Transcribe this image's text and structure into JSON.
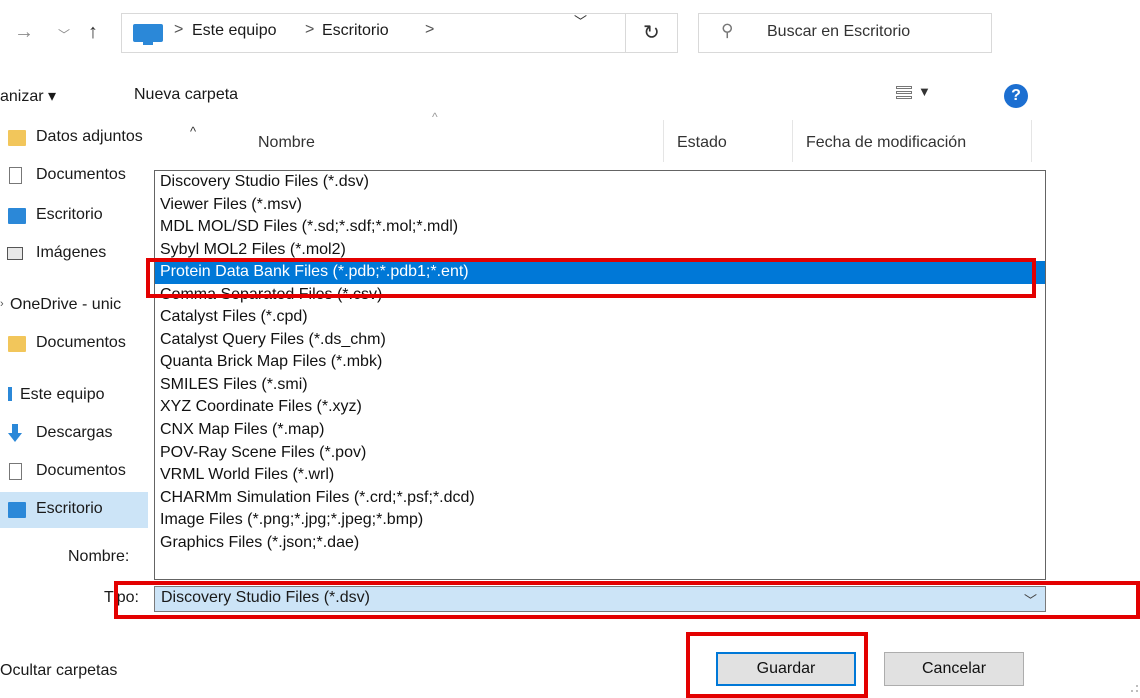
{
  "address_bar": {
    "breadcrumbs": [
      "Este equipo",
      "Escritorio"
    ],
    "separator": ">",
    "search_placeholder": "Buscar en Escritorio"
  },
  "toolbar": {
    "organize_label": "anizar ▾",
    "new_folder_label": "Nueva carpeta"
  },
  "columns": {
    "name": "Nombre",
    "status": "Estado",
    "modified": "Fecha de modificación"
  },
  "nav": {
    "items": [
      {
        "label": "Datos adjuntos",
        "icon": "folder-icon"
      },
      {
        "label": "Documentos",
        "icon": "document-icon"
      },
      {
        "label": "Escritorio",
        "icon": "desktop-icon"
      },
      {
        "label": "Imágenes",
        "icon": "pictures-icon"
      },
      {
        "label": "OneDrive - unic",
        "icon": "chevron-right-icon"
      },
      {
        "label": "Documentos",
        "icon": "folder-icon"
      },
      {
        "label": "Este equipo",
        "icon": "computer-icon"
      },
      {
        "label": "Descargas",
        "icon": "download-icon"
      },
      {
        "label": "Documentos",
        "icon": "document-icon"
      },
      {
        "label": "Escritorio",
        "icon": "desktop-icon",
        "selected": true
      }
    ]
  },
  "form": {
    "filename_label": "Nombre:",
    "type_label": "Tipo:",
    "type_value": "Discovery Studio Files (*.dsv)"
  },
  "type_options": [
    "Discovery Studio Files (*.dsv)",
    "Viewer Files (*.msv)",
    "MDL MOL/SD Files (*.sd;*.sdf;*.mol;*.mdl)",
    "Sybyl MOL2 Files (*.mol2)",
    "Protein Data Bank Files (*.pdb;*.pdb1;*.ent)",
    "Comma Separated Files (*.csv)",
    "Catalyst Files (*.cpd)",
    "Catalyst Query Files (*.ds_chm)",
    "Quanta Brick Map Files (*.mbk)",
    "SMILES Files (*.smi)",
    "XYZ Coordinate Files (*.xyz)",
    "CNX Map Files (*.map)",
    "POV-Ray Scene Files (*.pov)",
    "VRML World Files (*.wrl)",
    "CHARMm Simulation Files (*.crd;*.psf;*.dcd)",
    "Image Files (*.png;*.jpg;*.jpeg;*.bmp)",
    "Graphics Files (*.json;*.dae)"
  ],
  "highlighted_option_index": 4,
  "buttons": {
    "save": "Guardar",
    "cancel": "Cancelar",
    "hide_folders": "Ocultar carpetas"
  },
  "colors": {
    "accent": "#0078d7",
    "selection": "#cce4f7",
    "annotation": "#e30000"
  }
}
